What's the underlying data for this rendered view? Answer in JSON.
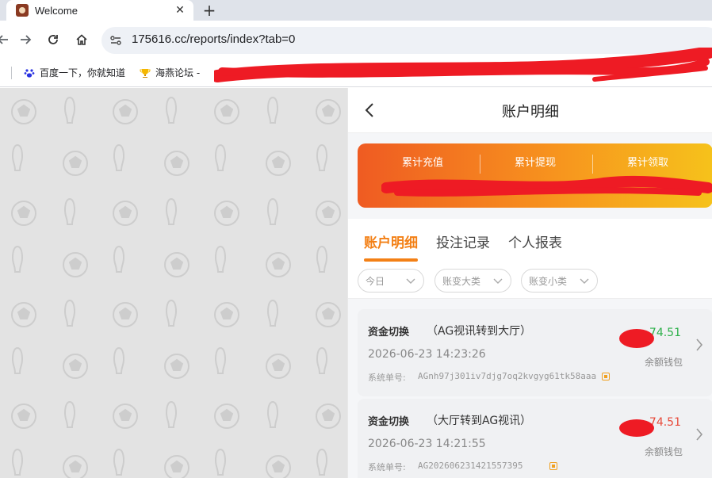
{
  "browser": {
    "tab_title": "Welcome",
    "url": "175616.cc/reports/index?tab=0",
    "bookmarks": [
      {
        "label": "百度一下，你就知道",
        "icon": "baidu-paw-icon"
      },
      {
        "label": "海燕论坛 -",
        "icon": "trophy-icon"
      }
    ]
  },
  "page": {
    "title": "账户明细",
    "summary": [
      {
        "label": "累计充值"
      },
      {
        "label": "累计提现"
      },
      {
        "label": "累计领取"
      }
    ],
    "tabs": [
      {
        "label": "账户明细",
        "active": true
      },
      {
        "label": "投注记录",
        "active": false
      },
      {
        "label": "个人报表",
        "active": false
      }
    ],
    "filters": [
      {
        "label": "今日"
      },
      {
        "label": "账变大类"
      },
      {
        "label": "账变小类"
      }
    ],
    "serial_label": "系统单号:",
    "wallet_label": "余额钱包",
    "transactions": [
      {
        "type": "资金切换",
        "desc": "（AG视讯转到大厅）",
        "time": "2026-06-23 14:23:26",
        "serial": "AGnh97j301iv7djg7oq2kvgyg61tk58aaa",
        "amount": "74.51",
        "amount_color": "#2db04a"
      },
      {
        "type": "资金切换",
        "desc": "（大厅转到AG视讯）",
        "time": "2026-06-23 14:21:55",
        "serial": "AG202606231421557395",
        "amount": "74.51",
        "amount_color": "#e84a3a"
      }
    ]
  },
  "colors": {
    "accent": "#f38016",
    "redaction": "#ee1b24"
  }
}
